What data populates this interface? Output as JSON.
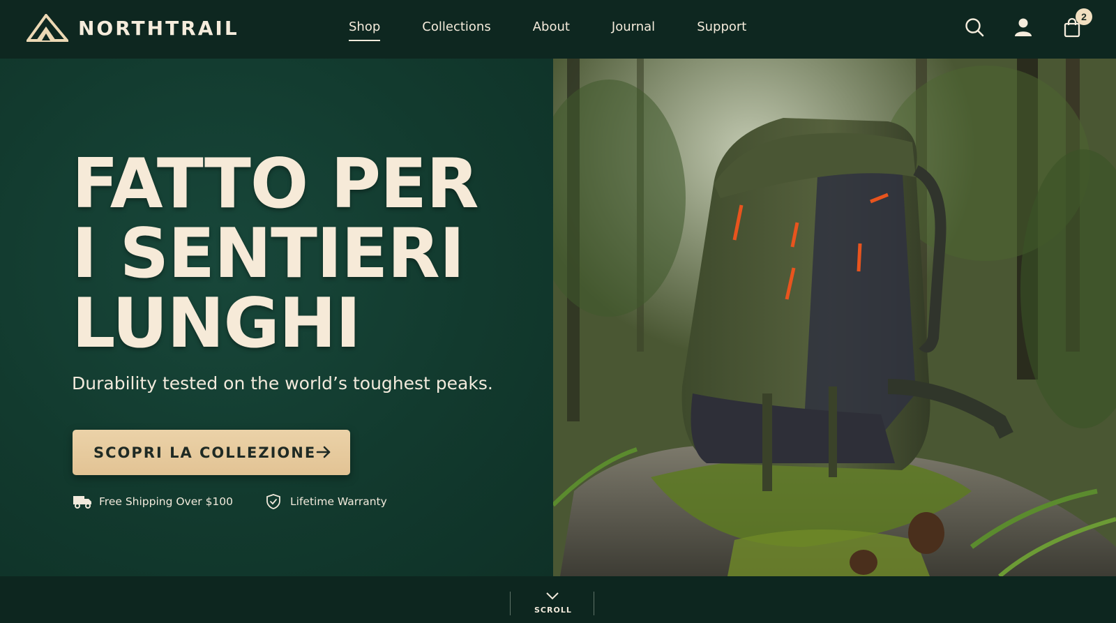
{
  "brand": {
    "name": "NORTHTRAIL"
  },
  "nav": {
    "items": [
      {
        "label": "Shop",
        "active": true
      },
      {
        "label": "Collections"
      },
      {
        "label": "About"
      },
      {
        "label": "Journal"
      },
      {
        "label": "Support"
      }
    ]
  },
  "header_icons": {
    "search": "search-icon",
    "account": "user-icon",
    "cart": "shopping-bag-icon",
    "cart_count": "2"
  },
  "hero": {
    "title_lines": [
      "FATTO PER",
      "I SENTIERI",
      "LUNGHI"
    ],
    "subtitle": "Durability tested on the world’s toughest peaks.",
    "cta_label": "SCOPRI LA COLLEZIONE",
    "perks": [
      {
        "icon": "truck-icon",
        "label": "Free Shipping Over $100"
      },
      {
        "icon": "shield-check-icon",
        "label": "Lifetime Warranty"
      }
    ]
  },
  "scroll": {
    "label": "SCROLL"
  },
  "colors": {
    "header_bg": "#0e2720",
    "hero_bg": "#123a2e",
    "cream": "#f5ecdc",
    "cta_bg": "#e6c99c",
    "accent_orange": "#e8541e"
  }
}
